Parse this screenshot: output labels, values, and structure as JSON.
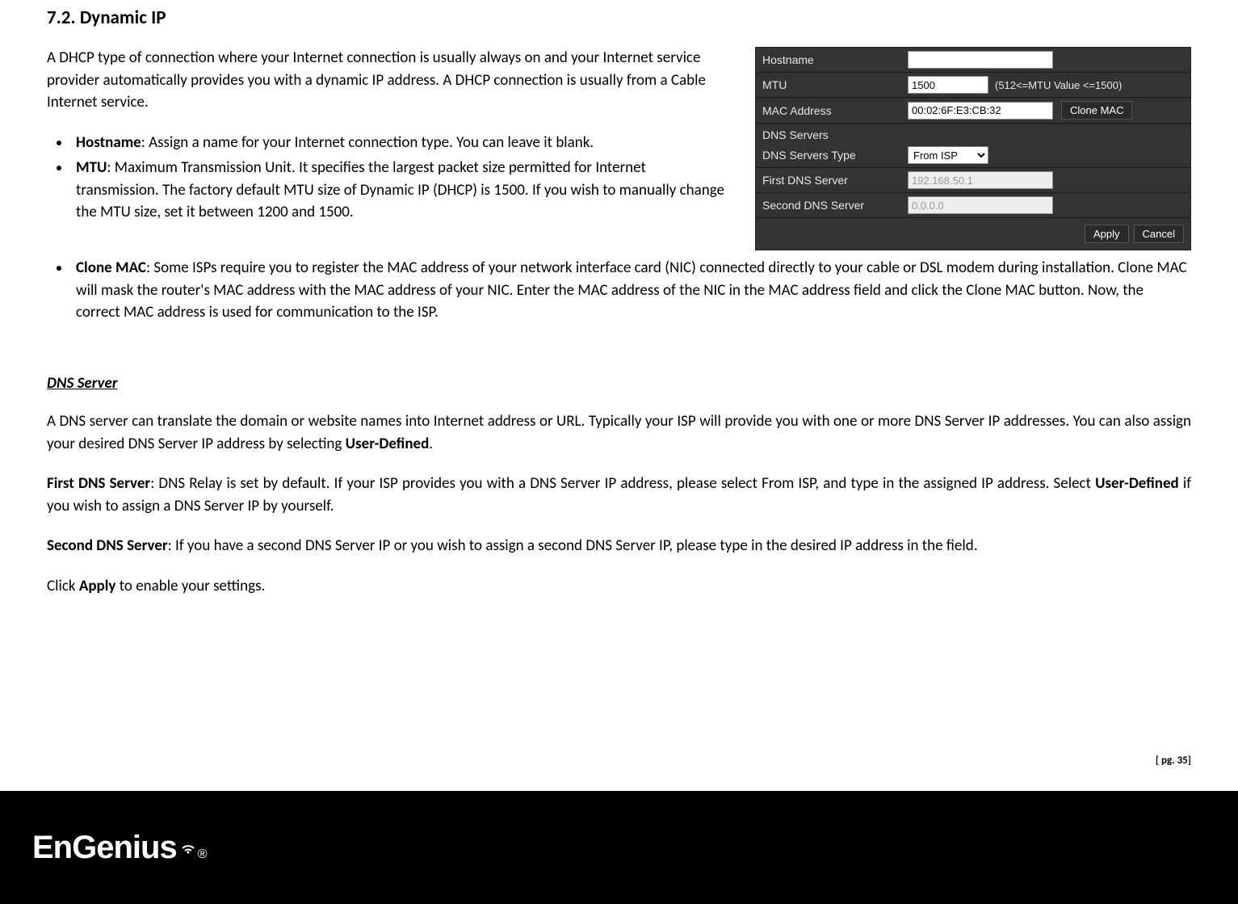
{
  "section_number": "7.2.",
  "section_title": "Dynamic IP",
  "intro": "A DHCP type of connection where your Internet connection is usually always on and your Internet service provider automatically provides you with a dynamic IP address. A DHCP connection is usually from a Cable Internet service.",
  "bullets": {
    "0": {
      "label": "Hostname",
      "desc": ": Assign a name for your Internet connection type. You can leave it blank."
    },
    "1": {
      "label": "MTU",
      "desc": ": Maximum Transmission Unit. It specifies the largest packet size permitted for Internet transmission. The factory default MTU size of Dynamic IP (DHCP) is 1500. If you wish to manually change the MTU size, set it between 1200 and 1500."
    },
    "2": {
      "label": "Clone MAC",
      "desc": ": Some ISPs require you to register the MAC address of your network interface card (NIC) connected directly to your cable or DSL modem during installation. Clone MAC will mask the router's MAC address with the MAC address of your NIC. Enter the MAC address of the NIC in the MAC address field and click the Clone MAC button. Now, the correct MAC address is used for communication to the ISP."
    }
  },
  "panel": {
    "hostname_label": "Hostname",
    "hostname_value": "",
    "mtu_label": "MTU",
    "mtu_value": "1500",
    "mtu_hint": "(512<=MTU Value <=1500)",
    "mac_label": "MAC Address",
    "mac_value": "00:02:6F:E3:CB:32",
    "clone_mac_btn": "Clone MAC",
    "dns_header": "DNS Servers",
    "dns_type_label": "DNS Servers Type",
    "dns_type_value": "From ISP",
    "first_dns_label": "First DNS Server",
    "first_dns_value": "192.168.50.1",
    "second_dns_label": "Second DNS Server",
    "second_dns_value": "0.0.0.0",
    "apply_btn": "Apply",
    "cancel_btn": "Cancel"
  },
  "dns_section": {
    "title": "DNS Server",
    "p1_a": "A DNS server can translate the domain or website names into Internet address or URL. Typically your ISP will provide you with one or more DNS Server IP addresses. You can also assign your desired DNS Server IP address by selecting ",
    "p1_b": "User-Defined",
    "p1_c": ".",
    "p2_a": "First DNS Server",
    "p2_b": ": DNS Relay is set by default. If your ISP provides you with a DNS Server IP address, please select From ISP, and type in the assigned IP address. Select ",
    "p2_c": "User-Defined",
    "p2_d": " if you wish to assign a DNS Server IP by yourself.",
    "p3_a": "Second DNS Server",
    "p3_b": ": If you have a second DNS Server IP or you wish to assign a second DNS Server IP, please type in the desired IP address in the field.",
    "p4_a": "Click ",
    "p4_b": "Apply",
    "p4_c": " to enable your settings."
  },
  "page_num": "[ pg. 35]",
  "logo_text": "EnGenius",
  "logo_reg": "®"
}
